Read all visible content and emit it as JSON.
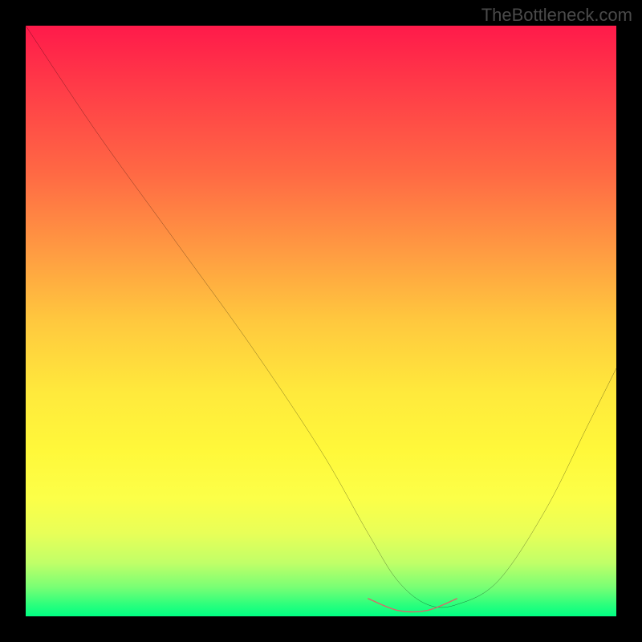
{
  "watermark": "TheBottleneck.com",
  "chart_data": {
    "type": "line",
    "title": "",
    "xlabel": "",
    "ylabel": "",
    "xlim": [
      0,
      100
    ],
    "ylim": [
      0,
      100
    ],
    "series": [
      {
        "name": "main-curve",
        "color": "#000000",
        "x": [
          0,
          12,
          25,
          38,
          50,
          58,
          63,
          68,
          73,
          80,
          88,
          95,
          100
        ],
        "values": [
          100,
          82,
          64,
          46,
          28,
          14,
          6,
          2,
          2,
          6,
          18,
          32,
          42
        ]
      },
      {
        "name": "highlight-segment",
        "color": "#d66a6a",
        "x": [
          58,
          63,
          68,
          73
        ],
        "values": [
          3,
          1,
          1,
          3
        ]
      }
    ],
    "background_gradient": {
      "top": "#ff1a4a",
      "bottom": "#00ff83"
    }
  }
}
